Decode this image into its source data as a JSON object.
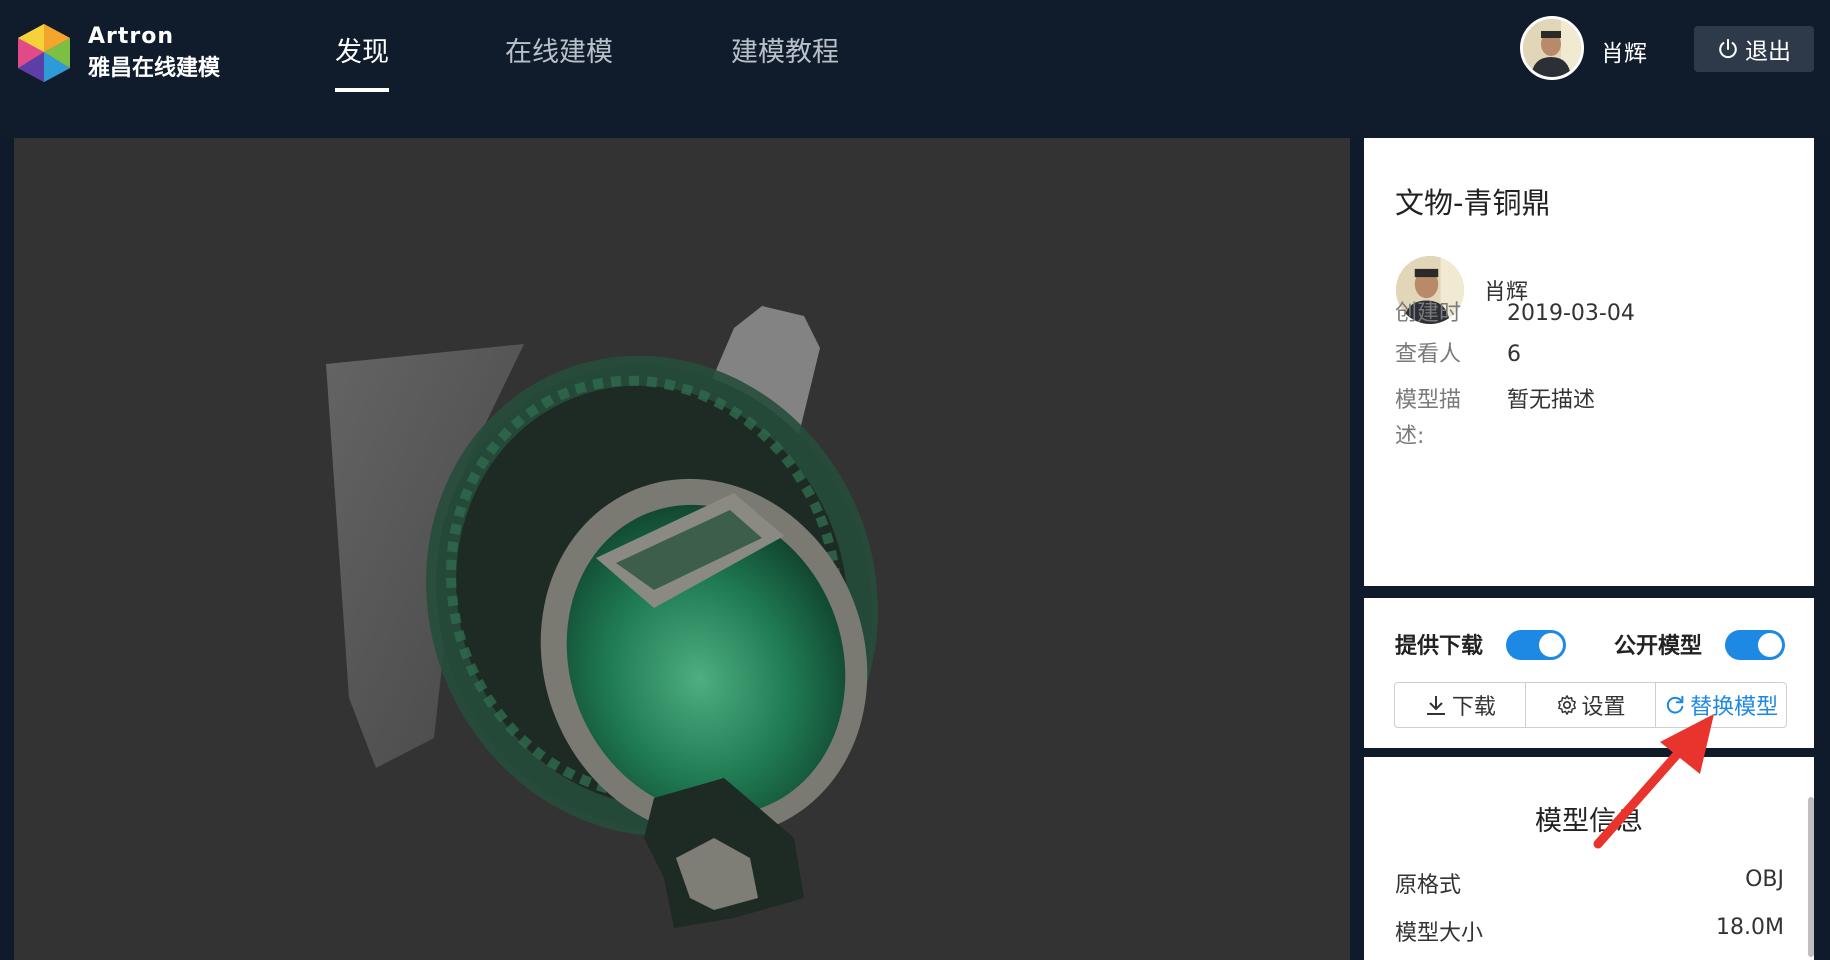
{
  "brand": {
    "name_en": "Artron",
    "name_cn": "雅昌在线建模"
  },
  "nav": {
    "items": [
      {
        "label": "发现",
        "active": true
      },
      {
        "label": "在线建模",
        "active": false
      },
      {
        "label": "建模教程",
        "active": false
      }
    ]
  },
  "user": {
    "name": "肖辉",
    "logout_label": "退出"
  },
  "model": {
    "title": "文物-青铜鼎",
    "owner": "肖辉",
    "created_label": "创建时",
    "created_value": "2019-03-04",
    "viewers_label": "查看人",
    "viewers_value": "6",
    "desc_label": "模型描述:",
    "desc_value": "暂无描述"
  },
  "actions": {
    "download_toggle_label": "提供下载",
    "download_toggle_on": true,
    "public_toggle_label": "公开模型",
    "public_toggle_on": true,
    "download_button": "下载",
    "settings_button": "设置",
    "replace_button": "替换模型"
  },
  "model_info": {
    "title": "模型信息",
    "rows": [
      {
        "label": "原格式",
        "value": "OBJ"
      },
      {
        "label": "模型大小",
        "value": "18.0M"
      }
    ]
  },
  "colors": {
    "accent": "#1e88e5",
    "header_bg": "#101c2b",
    "viewer_bg": "#333333",
    "annotation": "#e8342c"
  },
  "icons": [
    "power-icon",
    "download-icon",
    "gear-icon",
    "refresh-icon"
  ]
}
